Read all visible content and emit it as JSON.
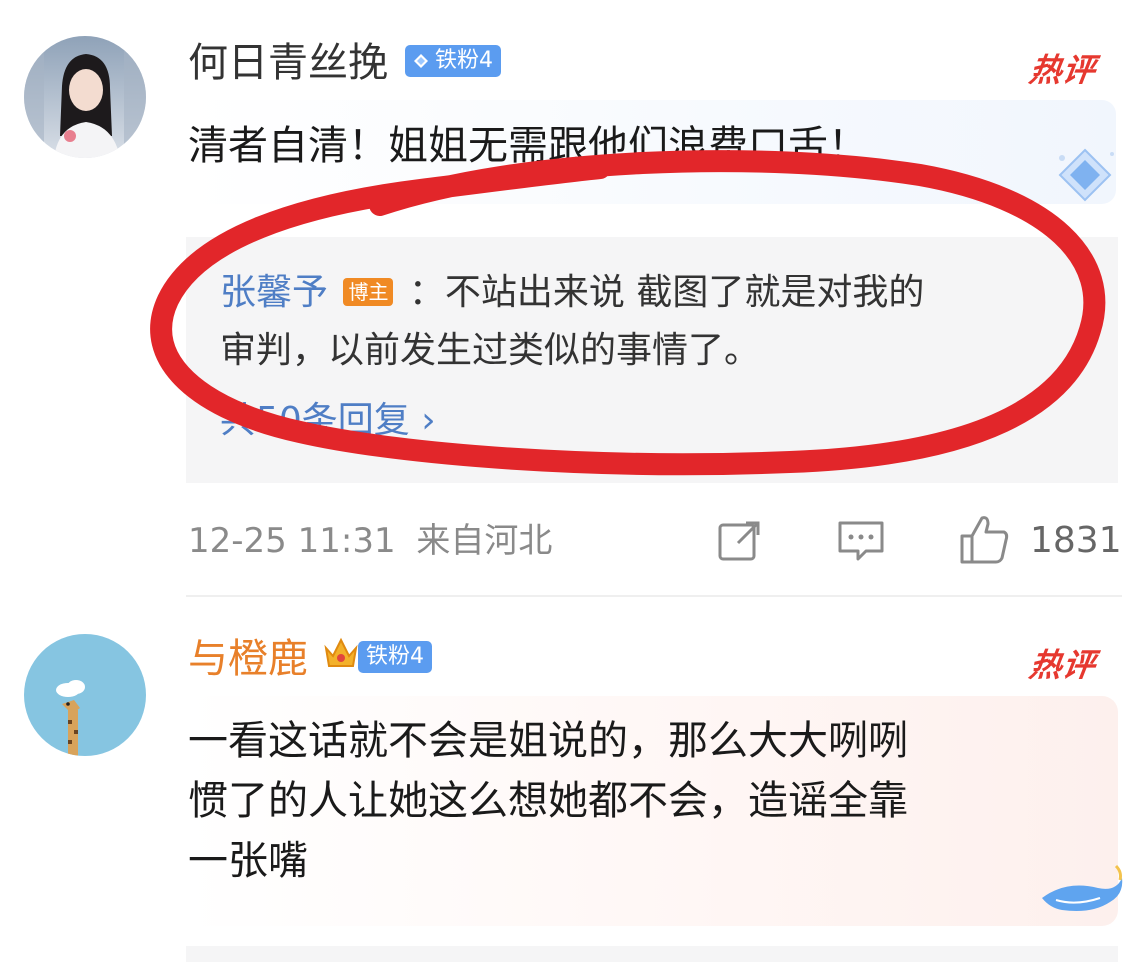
{
  "comments": [
    {
      "username": "何日青丝挽",
      "fan_badge": "铁粉4",
      "hot_tag": "热评",
      "text": "清者自清！姐姐无需跟他们浪费口舌！",
      "reply": {
        "author": "张馨予",
        "author_tag": "博主",
        "line1": "：不站出来说 截图了就是对我的",
        "line2": "审判，以前发生过类似的事情了。",
        "more": "共50条回复 ›"
      },
      "timestamp": "12-25 11:31",
      "location": "来自河北",
      "like_count": "1831"
    },
    {
      "username": "与橙鹿",
      "fan_badge": "铁粉4",
      "hot_tag": "热评",
      "text_lines": [
        "一看这话就不会是姐说的，那么大大咧咧",
        "惯了的人让她这么想她都不会，造谣全靠",
        "一张嘴"
      ]
    }
  ],
  "colors": {
    "accent_blue": "#4f7ec5",
    "hot_red": "#e6382f",
    "annotation_red": "#e2262a",
    "badge_blue": "#5b9cf0",
    "blogger_orange": "#f08a24",
    "username_orange": "#e8802a"
  }
}
